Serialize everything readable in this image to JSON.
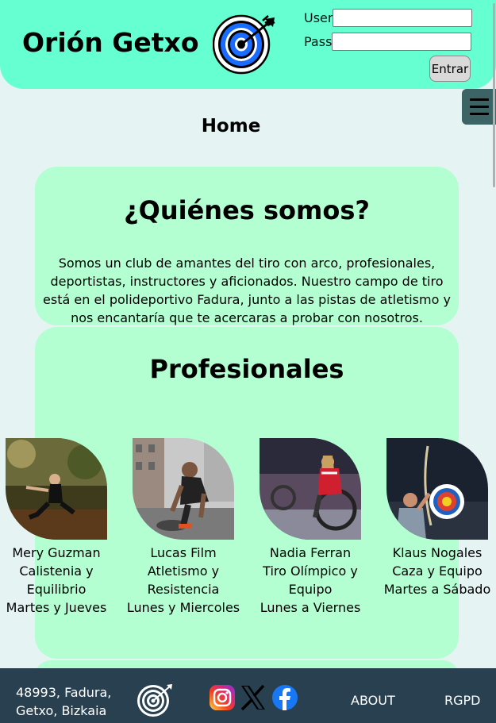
{
  "header": {
    "brand": "Orión Getxo",
    "login": {
      "user_label": "User",
      "pass_label": "Pass",
      "user_value": "",
      "pass_value": "",
      "submit_label": "Entrar"
    },
    "menu_icon": "hamburger-icon"
  },
  "page_title": "Home",
  "about": {
    "heading": "¿Quiénes somos?",
    "text": "Somos un club de amantes del tiro con arco, profesionales, deportistas, instructores y aficionados. Nuestro campo de tiro está en el polideportivo Fadura, junto a las pistas de atletismo y nos encantaría que te acercaras a probar con nosotros."
  },
  "professionals": {
    "heading": "Profesionales",
    "items": [
      {
        "name": "Mery Guzman",
        "specialty": "Calistenia y Equilibrio",
        "days": "Martes y Jueves"
      },
      {
        "name": "Lucas Film",
        "specialty": "Atletismo y Resistencia",
        "days": "Lunes y Miercoles"
      },
      {
        "name": "Nadia Ferran",
        "specialty": "Tiro Olímpico y Equipo",
        "days": "Lunes a Viernes"
      },
      {
        "name": "Klaus Nogales",
        "specialty": "Caza y Equipo",
        "days": "Martes a Sábado"
      }
    ]
  },
  "footer": {
    "address_line1": "48993, Fadura,",
    "address_line2": "Getxo, Bizkaia",
    "social_icons": [
      "instagram-icon",
      "x-icon",
      "facebook-icon"
    ],
    "about_link": "ABOUT",
    "rgpd_link": "RGPD"
  },
  "colors": {
    "header_bg": "#66ffd1",
    "page_bg": "#e6f3f3",
    "card_bg": "#b3ffd2",
    "footer_bg": "#28404f",
    "menu_bg": "#3c6464"
  }
}
